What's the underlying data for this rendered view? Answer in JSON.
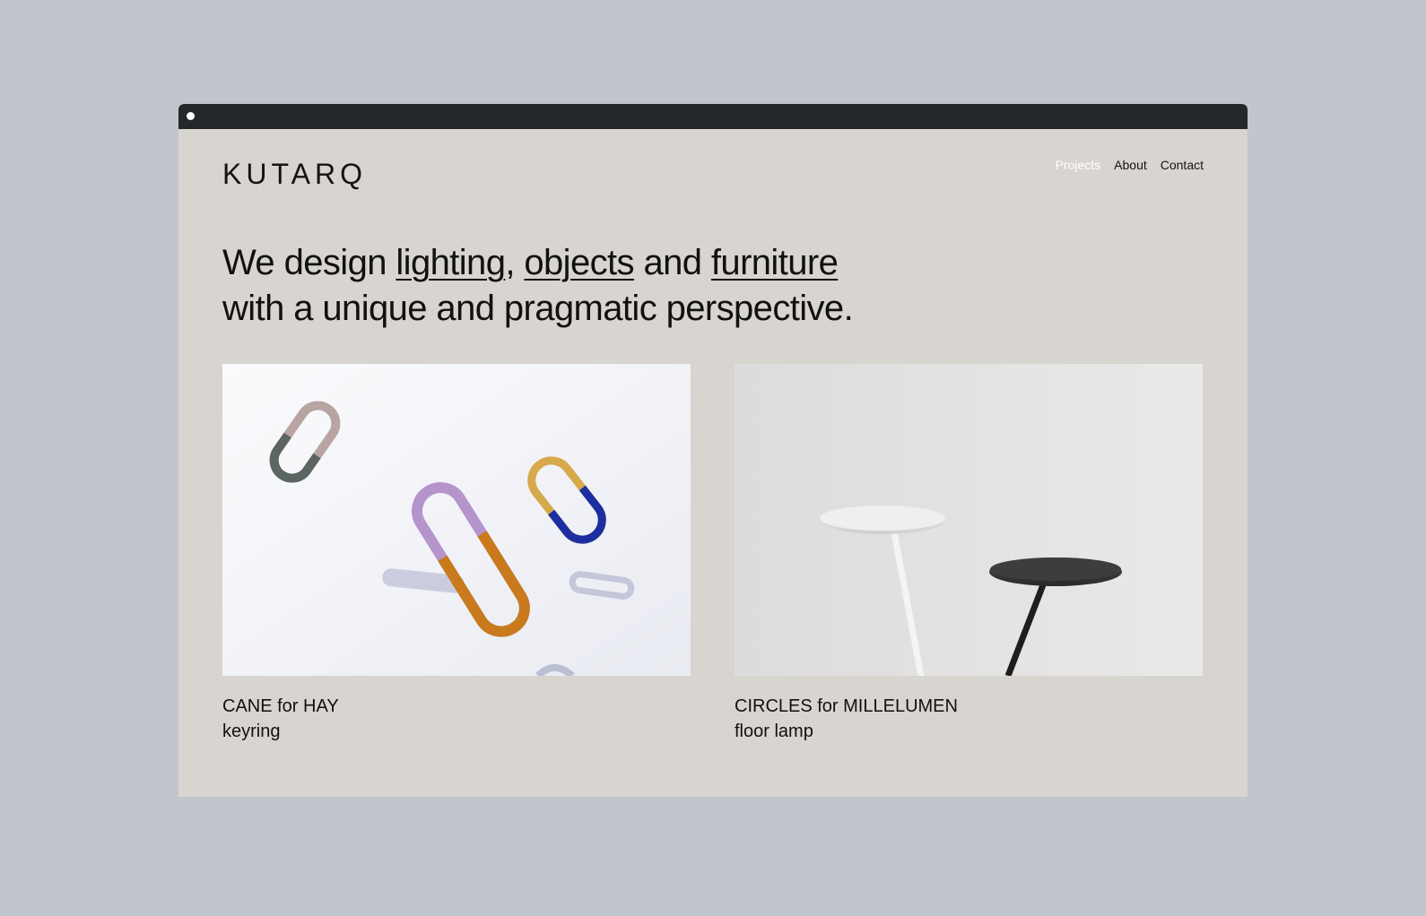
{
  "brand": {
    "logo": "KUTARQ"
  },
  "nav": {
    "items": [
      {
        "label": "Projects",
        "active": true
      },
      {
        "label": "About",
        "active": false
      },
      {
        "label": "Contact",
        "active": false
      }
    ]
  },
  "hero": {
    "part1": "We design ",
    "link1": "lighting",
    "sep1": ", ",
    "link2": "objects",
    "sep2": " and ",
    "link3": "furniture",
    "line2": "with a unique and pragmatic perspective."
  },
  "projects": [
    {
      "title": "CANE for HAY",
      "subtitle": "keyring"
    },
    {
      "title": "CIRCLES for MILLELUMEN",
      "subtitle": "floor lamp"
    }
  ],
  "colors": {
    "page_bg": "#c1c6cd",
    "window_bg": "#d8d4cf",
    "titlebar": "#24282b",
    "nav_active": "#ffffff"
  }
}
